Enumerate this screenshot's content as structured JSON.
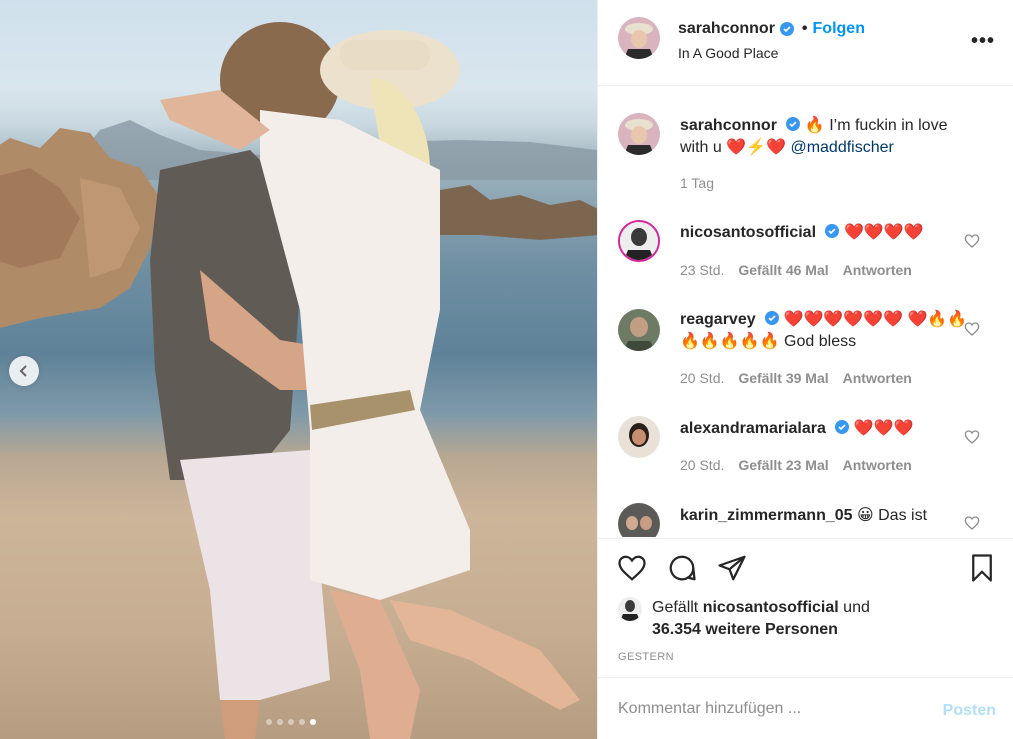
{
  "post": {
    "username": "sarahconnor",
    "follow_label": "Folgen",
    "follow_separator": "•",
    "location": "In A Good Place",
    "more_label": "•••"
  },
  "caption": {
    "username": "sarahconnor",
    "text_a": "🔥 I’m fuckin in love with u ❤️⚡️❤️ ",
    "mention": "@maddfischer",
    "time": "1 Tag"
  },
  "comments": [
    {
      "username": "nicosantosofficial",
      "text": "❤️❤️❤️❤️",
      "time": "23 Std.",
      "likes": "Gefällt 46 Mal",
      "reply": "Antworten"
    },
    {
      "username": "reagarvey",
      "text": "❤️❤️❤️❤️❤️❤️ ❤️🔥🔥🔥🔥🔥🔥🔥 God bless",
      "time": "20 Std.",
      "likes": "Gefällt 39 Mal",
      "reply": "Antworten"
    },
    {
      "username": "alexandramarialara",
      "text": "❤️❤️❤️",
      "time": "20 Std.",
      "likes": "Gefällt 23 Mal",
      "reply": "Antworten"
    },
    {
      "username": "karin_zimmermann_05",
      "text": "😀 Das ist",
      "time": "",
      "likes": "",
      "reply": ""
    }
  ],
  "likes": {
    "prefix": "Gefällt ",
    "user": "nicosantosofficial",
    "middle": " und ",
    "count": "36.354 weitere Personen"
  },
  "date": "GESTERN",
  "add_comment": {
    "placeholder": "Kommentar hinzufügen ...",
    "post_label": "Posten"
  },
  "carousel": {
    "slide_count": 5,
    "active_index": 4
  },
  "colors": {
    "accent": "#0095f6",
    "verified": "#3897f0",
    "muted": "#8e8e8e",
    "post_disabled": "#b2dffc"
  },
  "icons": [
    "verified-badge-icon",
    "more-options-icon",
    "heart-icon",
    "comment-icon",
    "share-icon",
    "bookmark-icon",
    "chevron-left-icon"
  ]
}
